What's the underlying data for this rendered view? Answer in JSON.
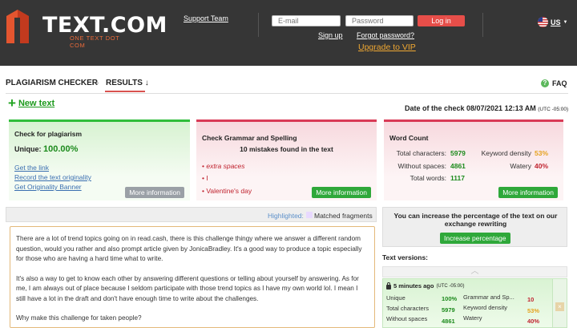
{
  "header": {
    "logo_text": "TEXT.COM",
    "logo_tagline": "ONE TEXT DOT COM",
    "support": "Support Team",
    "email_placeholder": "E-mail",
    "password_placeholder": "Password",
    "login": "Log in",
    "signup": "Sign up",
    "forgot": "Forgot password?",
    "vip": "Upgrade to VIP",
    "lang": "US"
  },
  "tabs": {
    "checker": "PLAGIARISM CHECKER",
    "arrow": "›",
    "results": "RESULTS ↓",
    "faq": "FAQ"
  },
  "new_text": "New text",
  "date": {
    "label": "Date of the check 08/07/2021 12:13 AM",
    "tz": "(UTC -05:00)"
  },
  "plagiarism": {
    "title": "Check for plagiarism",
    "unique_label": "Unique:",
    "unique_value": "100.00%",
    "links": [
      "Get the link",
      "Record the text originality",
      "Get Originality Banner"
    ],
    "more": "More information"
  },
  "grammar": {
    "title": "Check Grammar and Spelling",
    "summary": "10 mistakes found in the text",
    "mistakes": [
      "extra spaces",
      "I",
      "Valentine's day"
    ],
    "more": "More information"
  },
  "wordcount": {
    "title": "Word Count",
    "total_chars_label": "Total characters:",
    "total_chars": "5979",
    "no_spaces_label": "Without spaces:",
    "no_spaces": "4861",
    "total_words_label": "Total words:",
    "total_words": "1117",
    "keyword_label": "Keyword density",
    "keyword": "53%",
    "watery_label": "Watery",
    "watery": "40%",
    "more": "More information"
  },
  "highlight": {
    "label": "Highlighted:",
    "legend": "Matched fragments"
  },
  "text_paragraphs": [
    "There are a lot of trend topics going on in read.cash, there is this challenge thingy where we answer a different random question, would you rather and also prompt article given by JonicaBradley. It's a good way to produce a topic especially for those who are having a hard time what to write.",
    "It's also a way to get to know each other by answering different questions or telling about yourself by answering. As for me, I am always out of place because I seldom participate with those trend topics as I have my own world lol. I mean I still have a lot in the draft and don't have enough time to write about the challenges.",
    "Why make this challenge for taken people?"
  ],
  "tip": {
    "text": "You can increase the percentage of the text on our exchange rewriting",
    "button": "Increase percentage"
  },
  "versions": {
    "title": "Text versions:",
    "time": "5 minutes ago",
    "tz": "(UTC -05:00)",
    "unique_label": "Unique",
    "unique": "100%",
    "total_chars_label": "Total characters",
    "total_chars": "5979",
    "no_spaces_label": "Without spaces",
    "no_spaces": "4861",
    "grammar_label": "Grammar and Sp...",
    "grammar": "10",
    "keyword_label": "Keyword density",
    "keyword": "53%",
    "watery_label": "Watery",
    "watery": "40%",
    "close": "×"
  },
  "colors": {
    "accent_green": "#2fa83a",
    "accent_red": "#d93a56",
    "login_red": "#e74e49",
    "vip_orange": "#f0a832"
  }
}
